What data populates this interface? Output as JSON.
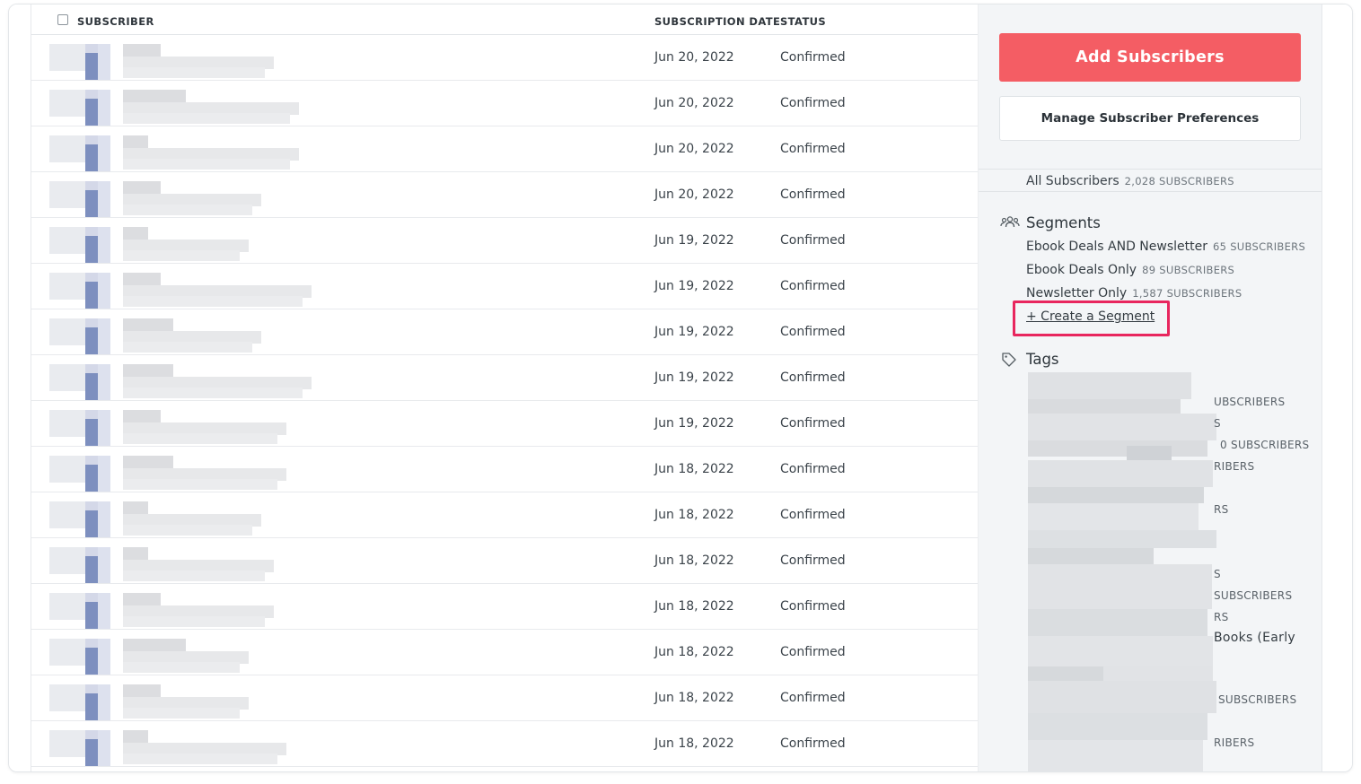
{
  "table": {
    "columns": {
      "subscriber": "SUBSCRIBER",
      "date": "SUBSCRIPTION DATE",
      "status": "STATUS"
    },
    "rows": [
      {
        "date": "Jun 20, 2022",
        "status": "Confirmed"
      },
      {
        "date": "Jun 20, 2022",
        "status": "Confirmed"
      },
      {
        "date": "Jun 20, 2022",
        "status": "Confirmed"
      },
      {
        "date": "Jun 20, 2022",
        "status": "Confirmed"
      },
      {
        "date": "Jun 19, 2022",
        "status": "Confirmed"
      },
      {
        "date": "Jun 19, 2022",
        "status": "Confirmed"
      },
      {
        "date": "Jun 19, 2022",
        "status": "Confirmed"
      },
      {
        "date": "Jun 19, 2022",
        "status": "Confirmed"
      },
      {
        "date": "Jun 19, 2022",
        "status": "Confirmed"
      },
      {
        "date": "Jun 18, 2022",
        "status": "Confirmed"
      },
      {
        "date": "Jun 18, 2022",
        "status": "Confirmed"
      },
      {
        "date": "Jun 18, 2022",
        "status": "Confirmed"
      },
      {
        "date": "Jun 18, 2022",
        "status": "Confirmed"
      },
      {
        "date": "Jun 18, 2022",
        "status": "Confirmed"
      },
      {
        "date": "Jun 18, 2022",
        "status": "Confirmed"
      },
      {
        "date": "Jun 18, 2022",
        "status": "Confirmed"
      }
    ]
  },
  "sidebar": {
    "add_button": "Add Subscribers",
    "manage_button": "Manage Subscriber Preferences",
    "all_subscribers": {
      "label": "All Subscribers",
      "count": "2,028 SUBSCRIBERS"
    },
    "segments": {
      "title": "Segments",
      "items": [
        {
          "label": "Ebook Deals AND Newsletter",
          "count": "65 SUBSCRIBERS"
        },
        {
          "label": "Ebook Deals Only",
          "count": "89 SUBSCRIBERS"
        },
        {
          "label": "Newsletter Only",
          "count": "1,587 SUBSCRIBERS"
        }
      ],
      "create_link": "+ Create a Segment"
    },
    "tags": {
      "title": "Tags",
      "visible_fragments": [
        "UBSCRIBERS",
        "S",
        "0 SUBSCRIBERS",
        "RIBERS",
        "RS",
        "S",
        "SUBSCRIBERS",
        "RS",
        "Books (Early",
        "SUBSCRIBERS",
        "RIBERS"
      ]
    }
  },
  "colors": {
    "accent": "#f45d64",
    "highlight": "#e8265e",
    "sidebar_bg": "#f3f5f7"
  }
}
